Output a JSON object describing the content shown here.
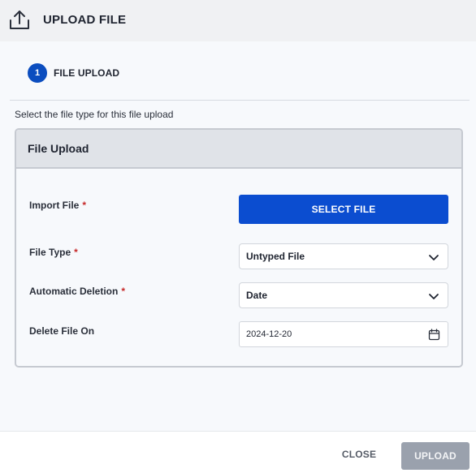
{
  "header": {
    "icon": "upload-icon",
    "title": "UPLOAD FILE"
  },
  "stepper": {
    "steps": [
      {
        "number": "1",
        "label": "FILE UPLOAD",
        "active": true
      }
    ]
  },
  "instruction": "Select the file type for this file upload",
  "panel": {
    "title": "File Upload",
    "required_marker": "*",
    "fields": {
      "import_file": {
        "label": "Import File",
        "required": true,
        "button_label": "SELECT FILE"
      },
      "file_type": {
        "label": "File Type",
        "required": true,
        "value": "Untyped File"
      },
      "automatic_deletion": {
        "label": "Automatic Deletion",
        "required": true,
        "value": "Date"
      },
      "delete_file_on": {
        "label": "Delete File On",
        "required": false,
        "value": "2024-12-20",
        "icon": "calendar-icon"
      }
    }
  },
  "footer": {
    "close_label": "CLOSE",
    "upload_label": "UPLOAD"
  },
  "colors": {
    "primary": "#0b4dd0",
    "step_active": "#0b4dbf",
    "required": "#c62828",
    "disabled_button": "#9aa1ad"
  }
}
